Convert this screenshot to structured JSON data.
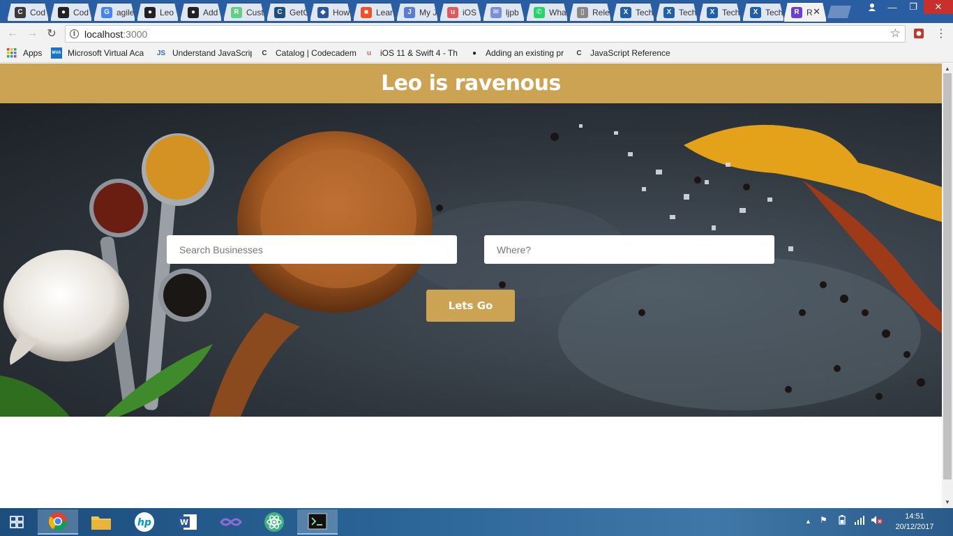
{
  "browser": {
    "tabs": [
      {
        "title": "Cod",
        "icon": "codecademy-icon",
        "color": "#3a3a3a",
        "glyph": "C"
      },
      {
        "title": "Cod",
        "icon": "github-icon",
        "color": "#222222",
        "glyph": "●"
      },
      {
        "title": "agile",
        "icon": "google-icon",
        "color": "#4285f4",
        "glyph": "G"
      },
      {
        "title": "Leo",
        "icon": "github-icon",
        "color": "#222222",
        "glyph": "●"
      },
      {
        "title": "Add",
        "icon": "github-icon",
        "color": "#222222",
        "glyph": "●"
      },
      {
        "title": "Cust",
        "icon": "treehouse-icon",
        "color": "#5fcf80",
        "glyph": "R"
      },
      {
        "title": "GetC",
        "icon": "getcode-icon",
        "color": "#1c4e80",
        "glyph": "C"
      },
      {
        "title": "How",
        "icon": "visual-studio-icon",
        "color": "#2b5797",
        "glyph": "◆"
      },
      {
        "title": "Lear",
        "icon": "microsoft-icon",
        "color": "#f25022",
        "glyph": "■"
      },
      {
        "title": "My J",
        "icon": "journal-icon",
        "color": "#5b7bd5",
        "glyph": "J"
      },
      {
        "title": "iOS",
        "icon": "udemy-icon",
        "color": "#e05a5a",
        "glyph": "u"
      },
      {
        "title": "ljpb",
        "icon": "mail-icon",
        "color": "#7a8fd8",
        "glyph": "✉"
      },
      {
        "title": "Wha",
        "icon": "whatsapp-icon",
        "color": "#25d366",
        "glyph": "✆"
      },
      {
        "title": "Rele",
        "icon": "document-icon",
        "color": "#888888",
        "glyph": "▯"
      },
      {
        "title": "Tech",
        "icon": "x-icon",
        "color": "#1f5ea8",
        "glyph": "X"
      },
      {
        "title": "Tech",
        "icon": "x-icon",
        "color": "#1f5ea8",
        "glyph": "X"
      },
      {
        "title": "Tech",
        "icon": "x-icon",
        "color": "#1f5ea8",
        "glyph": "X"
      },
      {
        "title": "Tech",
        "icon": "x-icon",
        "color": "#1f5ea8",
        "glyph": "X"
      },
      {
        "title": "R",
        "icon": "ravenous-icon",
        "color": "#6b3fd1",
        "glyph": "R"
      }
    ],
    "url_host": "localhost",
    "url_port": ":3000",
    "bookmarks": [
      {
        "label": "Apps",
        "icon": "apps-grid-icon"
      },
      {
        "label": "Microsoft Virtual Aca",
        "icon": "mva-icon"
      },
      {
        "label": "Understand JavaScrip",
        "icon": "js-icon"
      },
      {
        "label": "Catalog | Codecadem",
        "icon": "codecademy-icon"
      },
      {
        "label": "iOS 11 & Swift 4 - Th",
        "icon": "udemy-icon"
      },
      {
        "label": "Adding an existing pr",
        "icon": "github-icon"
      },
      {
        "label": "JavaScript Reference",
        "icon": "codecademy-icon"
      }
    ]
  },
  "app": {
    "title": "Leo is ravenous",
    "search_placeholder": "Search Businesses",
    "where_placeholder": "Where?",
    "go_label": "Lets Go",
    "accent": "#cca353"
  },
  "taskbar": {
    "time": "14:51",
    "date": "20/12/2017"
  }
}
